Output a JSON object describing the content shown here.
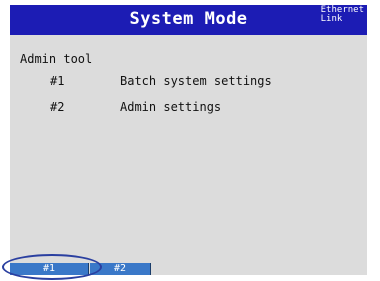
{
  "header": {
    "title": "System Mode",
    "status_line1": "Ethernet",
    "status_line2": "Link"
  },
  "menu": {
    "heading": "Admin tool",
    "items": [
      {
        "num": "#1",
        "label": "Batch system settings"
      },
      {
        "num": "#2",
        "label": "Admin settings"
      }
    ]
  },
  "softkeys": [
    {
      "label": "#1"
    },
    {
      "label": "#2"
    }
  ],
  "colors": {
    "titlebar": "#1c1cb4",
    "screen_bg": "#dcdcdc",
    "softkey_bg": "#3a78c8",
    "highlight_ring": "#2a3fa0"
  }
}
